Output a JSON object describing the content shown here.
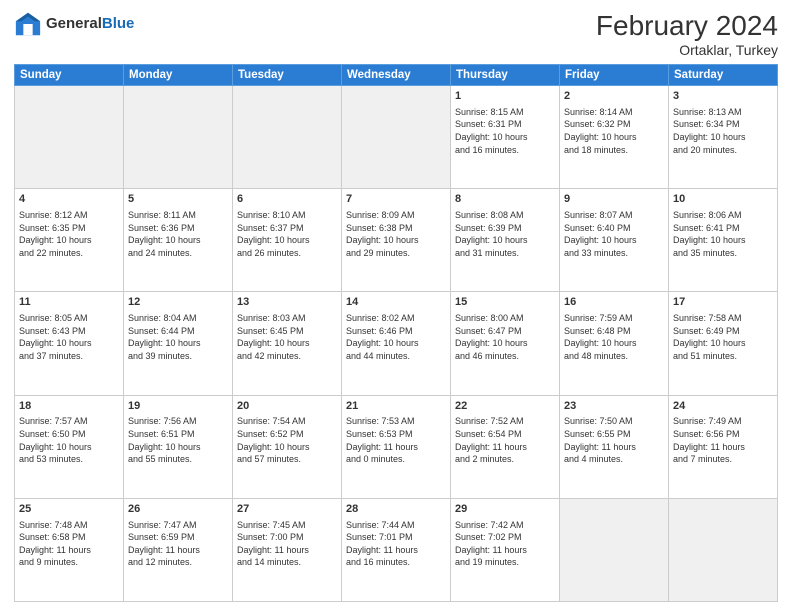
{
  "header": {
    "logo_general": "General",
    "logo_blue": "Blue",
    "month_year": "February 2024",
    "location": "Ortaklar, Turkey"
  },
  "weekdays": [
    "Sunday",
    "Monday",
    "Tuesday",
    "Wednesday",
    "Thursday",
    "Friday",
    "Saturday"
  ],
  "weeks": [
    [
      {
        "day": "",
        "info": ""
      },
      {
        "day": "",
        "info": ""
      },
      {
        "day": "",
        "info": ""
      },
      {
        "day": "",
        "info": ""
      },
      {
        "day": "1",
        "info": "Sunrise: 8:15 AM\nSunset: 6:31 PM\nDaylight: 10 hours\nand 16 minutes."
      },
      {
        "day": "2",
        "info": "Sunrise: 8:14 AM\nSunset: 6:32 PM\nDaylight: 10 hours\nand 18 minutes."
      },
      {
        "day": "3",
        "info": "Sunrise: 8:13 AM\nSunset: 6:34 PM\nDaylight: 10 hours\nand 20 minutes."
      }
    ],
    [
      {
        "day": "4",
        "info": "Sunrise: 8:12 AM\nSunset: 6:35 PM\nDaylight: 10 hours\nand 22 minutes."
      },
      {
        "day": "5",
        "info": "Sunrise: 8:11 AM\nSunset: 6:36 PM\nDaylight: 10 hours\nand 24 minutes."
      },
      {
        "day": "6",
        "info": "Sunrise: 8:10 AM\nSunset: 6:37 PM\nDaylight: 10 hours\nand 26 minutes."
      },
      {
        "day": "7",
        "info": "Sunrise: 8:09 AM\nSunset: 6:38 PM\nDaylight: 10 hours\nand 29 minutes."
      },
      {
        "day": "8",
        "info": "Sunrise: 8:08 AM\nSunset: 6:39 PM\nDaylight: 10 hours\nand 31 minutes."
      },
      {
        "day": "9",
        "info": "Sunrise: 8:07 AM\nSunset: 6:40 PM\nDaylight: 10 hours\nand 33 minutes."
      },
      {
        "day": "10",
        "info": "Sunrise: 8:06 AM\nSunset: 6:41 PM\nDaylight: 10 hours\nand 35 minutes."
      }
    ],
    [
      {
        "day": "11",
        "info": "Sunrise: 8:05 AM\nSunset: 6:43 PM\nDaylight: 10 hours\nand 37 minutes."
      },
      {
        "day": "12",
        "info": "Sunrise: 8:04 AM\nSunset: 6:44 PM\nDaylight: 10 hours\nand 39 minutes."
      },
      {
        "day": "13",
        "info": "Sunrise: 8:03 AM\nSunset: 6:45 PM\nDaylight: 10 hours\nand 42 minutes."
      },
      {
        "day": "14",
        "info": "Sunrise: 8:02 AM\nSunset: 6:46 PM\nDaylight: 10 hours\nand 44 minutes."
      },
      {
        "day": "15",
        "info": "Sunrise: 8:00 AM\nSunset: 6:47 PM\nDaylight: 10 hours\nand 46 minutes."
      },
      {
        "day": "16",
        "info": "Sunrise: 7:59 AM\nSunset: 6:48 PM\nDaylight: 10 hours\nand 48 minutes."
      },
      {
        "day": "17",
        "info": "Sunrise: 7:58 AM\nSunset: 6:49 PM\nDaylight: 10 hours\nand 51 minutes."
      }
    ],
    [
      {
        "day": "18",
        "info": "Sunrise: 7:57 AM\nSunset: 6:50 PM\nDaylight: 10 hours\nand 53 minutes."
      },
      {
        "day": "19",
        "info": "Sunrise: 7:56 AM\nSunset: 6:51 PM\nDaylight: 10 hours\nand 55 minutes."
      },
      {
        "day": "20",
        "info": "Sunrise: 7:54 AM\nSunset: 6:52 PM\nDaylight: 10 hours\nand 57 minutes."
      },
      {
        "day": "21",
        "info": "Sunrise: 7:53 AM\nSunset: 6:53 PM\nDaylight: 11 hours\nand 0 minutes."
      },
      {
        "day": "22",
        "info": "Sunrise: 7:52 AM\nSunset: 6:54 PM\nDaylight: 11 hours\nand 2 minutes."
      },
      {
        "day": "23",
        "info": "Sunrise: 7:50 AM\nSunset: 6:55 PM\nDaylight: 11 hours\nand 4 minutes."
      },
      {
        "day": "24",
        "info": "Sunrise: 7:49 AM\nSunset: 6:56 PM\nDaylight: 11 hours\nand 7 minutes."
      }
    ],
    [
      {
        "day": "25",
        "info": "Sunrise: 7:48 AM\nSunset: 6:58 PM\nDaylight: 11 hours\nand 9 minutes."
      },
      {
        "day": "26",
        "info": "Sunrise: 7:47 AM\nSunset: 6:59 PM\nDaylight: 11 hours\nand 12 minutes."
      },
      {
        "day": "27",
        "info": "Sunrise: 7:45 AM\nSunset: 7:00 PM\nDaylight: 11 hours\nand 14 minutes."
      },
      {
        "day": "28",
        "info": "Sunrise: 7:44 AM\nSunset: 7:01 PM\nDaylight: 11 hours\nand 16 minutes."
      },
      {
        "day": "29",
        "info": "Sunrise: 7:42 AM\nSunset: 7:02 PM\nDaylight: 11 hours\nand 19 minutes."
      },
      {
        "day": "",
        "info": ""
      },
      {
        "day": "",
        "info": ""
      }
    ]
  ]
}
